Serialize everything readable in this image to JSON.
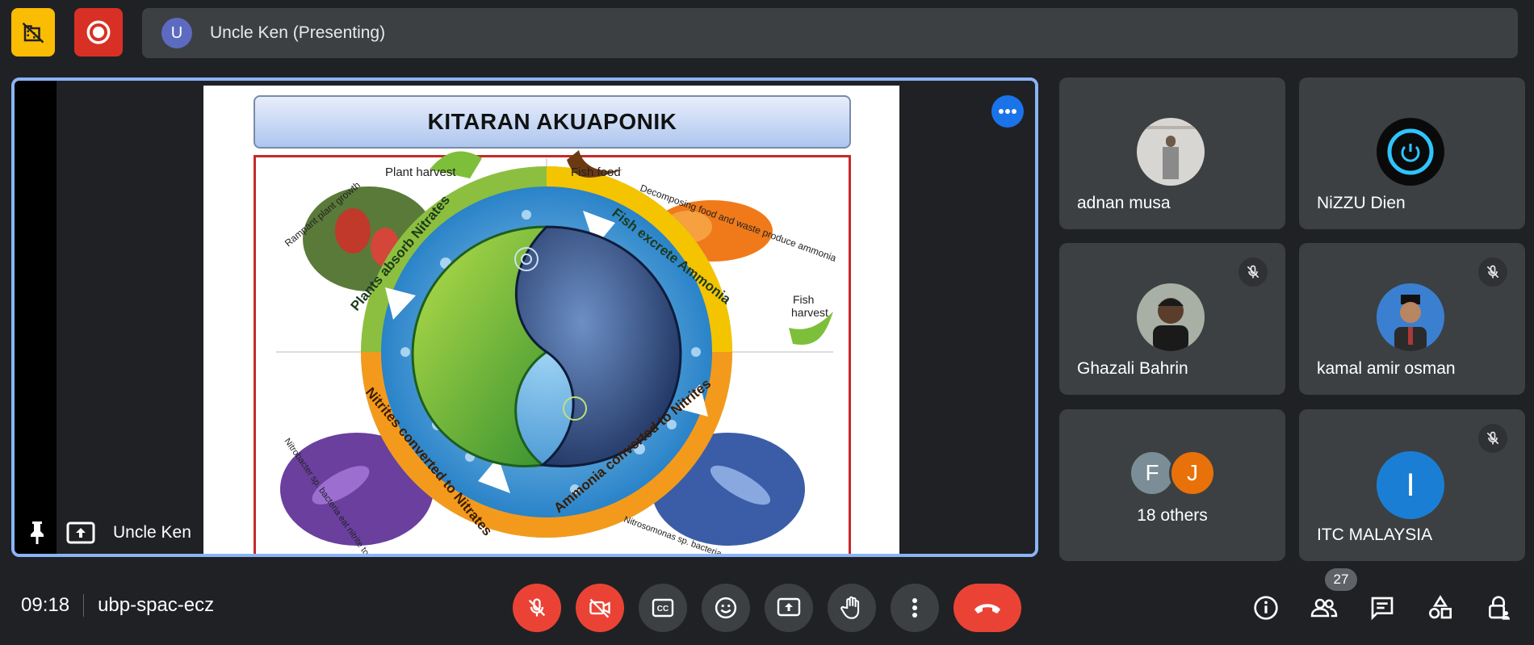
{
  "top_bar": {
    "presenter_initial": "U",
    "presenting_label": "Uncle Ken (Presenting)"
  },
  "stage": {
    "presenter_name": "Uncle Ken",
    "slide": {
      "title": "KITARAN AKUAPONIK",
      "labels": {
        "plant_harvest": "Plant harvest",
        "fish_food": "Fish food",
        "rampant": "Rampant plant growth",
        "decomposing": "Decomposing food and waste produce ammonia",
        "fish_harvest_1": "Fish",
        "fish_harvest_2": "harvest",
        "plants_absorb": "Plants absorb Nitrates",
        "fish_excrete": "Fish excrete Ammonia",
        "nitrites_converted": "Nitrites converted to Nitrates",
        "ammonia_converted": "Ammonia converted to Nitrites",
        "nitrobacter": "Nitrobacter sp. bacteria eat nitrite to grow",
        "nitrosomonas": "Nitrosomonas sp. bacteria eat ammonia to grow"
      }
    }
  },
  "participants": [
    {
      "name": "adnan musa",
      "muted": false
    },
    {
      "name": "NiZZU Dien",
      "muted": false
    },
    {
      "name": "Ghazali Bahrin",
      "muted": true
    },
    {
      "name": "kamal amir osman",
      "muted": true
    },
    {
      "name": "18 others",
      "initials": [
        "F",
        "J"
      ]
    },
    {
      "name": "ITC MALAYSIA",
      "initial": "I",
      "muted": true
    }
  ],
  "bottom_bar": {
    "time": "09:18",
    "meeting_code": "ubp-spac-ecz",
    "participant_count": "27"
  },
  "colors": {
    "accent_blue": "#8ab4f8",
    "red": "#ea4335",
    "yellow": "#fbbc04",
    "tile": "#3c4043",
    "bg": "#202124"
  }
}
